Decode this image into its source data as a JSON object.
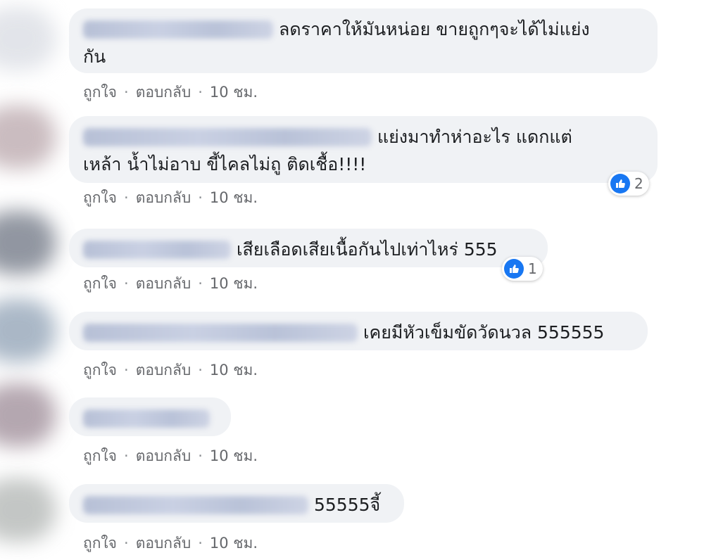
{
  "actions": {
    "like": "ถูกใจ",
    "reply": "ตอบกลับ",
    "separator": "·",
    "time": "10 ชม."
  },
  "colors": {
    "bubble": "#f0f2f5",
    "meta_text": "#65676b",
    "like_blue": "#1877f2"
  },
  "comments": [
    {
      "text_line1": "ลดราคาให้มันหน่อย ขายถูกๆจะได้ไม่แย่ง",
      "text_line2": "กัน",
      "reactions": null
    },
    {
      "text_line1": "แย่งมาทำห่าอะไร แดกแต่",
      "text_line2": "เหล้า น้ำไม่อาบ ขี้ไคลไม่ถู ติดเชื้อ!!!!",
      "reactions": "2"
    },
    {
      "text_line1": "เสียเลือดเสียเนื้อกันไปเท่าไหร่ 555",
      "reactions": "1"
    },
    {
      "text_line1": "เคยมีหัวเข็มขัดวัดนวล 555555",
      "reactions": null
    },
    {
      "text_line1": "",
      "reactions": null
    },
    {
      "text_line1": "55555จี้",
      "reactions": null
    }
  ]
}
